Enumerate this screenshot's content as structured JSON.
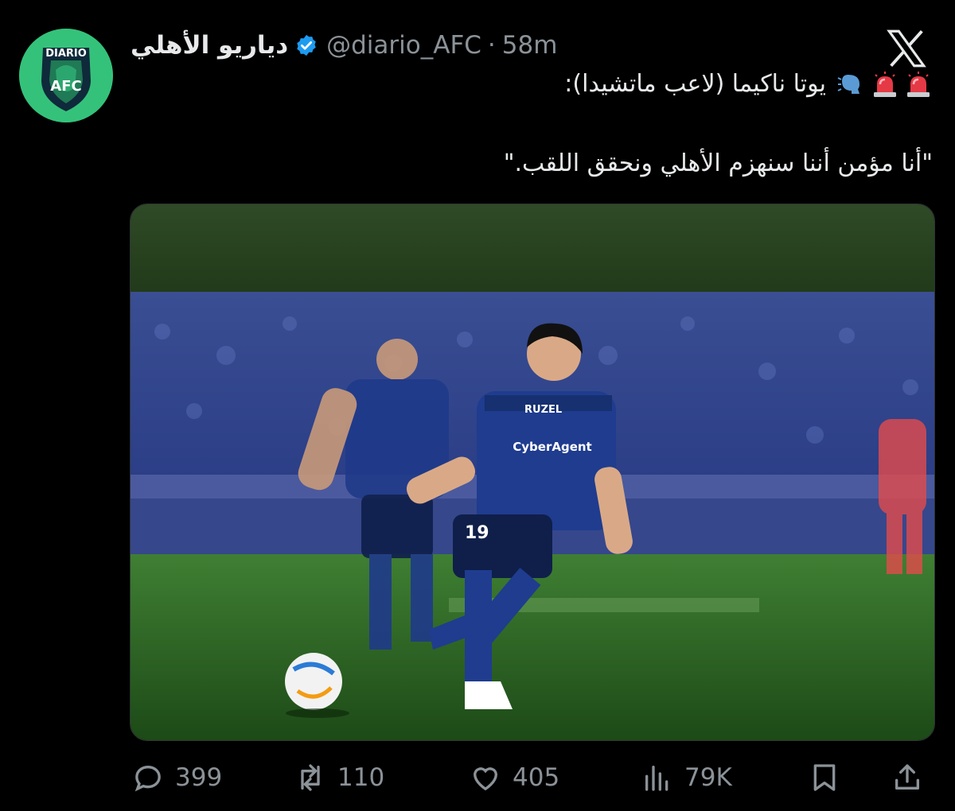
{
  "post": {
    "author": {
      "display_name": "دياريو الأهلي",
      "handle": "@diario_AFC",
      "time_ago": "58m",
      "separator": "·",
      "verified": true,
      "avatar": {
        "top_text": "DIARIO",
        "bottom_text": "AFC",
        "bg_color": "#34c27a"
      }
    },
    "text_line1": "يوتا ناكيما (لاعب ماتشيدا):",
    "text_line2": "\"أنا مؤمن أننا سنهزم الأهلي ونحقق اللقب.\"",
    "emojis": [
      "siren-icon",
      "siren-icon",
      "speaking-head-icon"
    ],
    "image": {
      "description_icon": "football-player-photo",
      "shirt_sponsor": "CyberAgent",
      "shirt_number": "19",
      "shirt_logo": "RUZEL"
    }
  },
  "actions": {
    "replies": "399",
    "reposts": "110",
    "likes": "405",
    "views": "79K"
  },
  "icons": {
    "reply": "reply-icon",
    "repost": "repost-icon",
    "like": "heart-icon",
    "views": "views-chart-icon",
    "bookmark": "bookmark-icon",
    "share": "share-icon",
    "brand": "x-logo-icon"
  },
  "colors": {
    "background": "#000000",
    "text": "#e7e9ea",
    "muted": "#8b9298",
    "verified": "#1d9bf0",
    "avatar": "#34c27a"
  }
}
